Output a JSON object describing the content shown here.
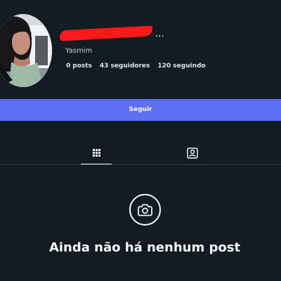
{
  "profile": {
    "display_name": "Yasmim",
    "username_ellipsis": "...",
    "stats": [
      {
        "value": "0",
        "label": "posts"
      },
      {
        "value": "43",
        "label": "seguidores"
      },
      {
        "value": "120",
        "label": "seguindo"
      }
    ],
    "follow_label": "Seguir"
  },
  "tabs": [
    {
      "name": "posts-grid",
      "icon": "grid-icon",
      "selected": true
    },
    {
      "name": "tagged",
      "icon": "person-tag-icon",
      "selected": false
    }
  ],
  "empty_state": {
    "icon": "camera-icon",
    "title": "Ainda não há nenhum post"
  },
  "colors": {
    "background": "#121c22",
    "follow_button": "#5f6ff3",
    "redaction": "#ff1a1a",
    "text": "#f2f4f5"
  }
}
